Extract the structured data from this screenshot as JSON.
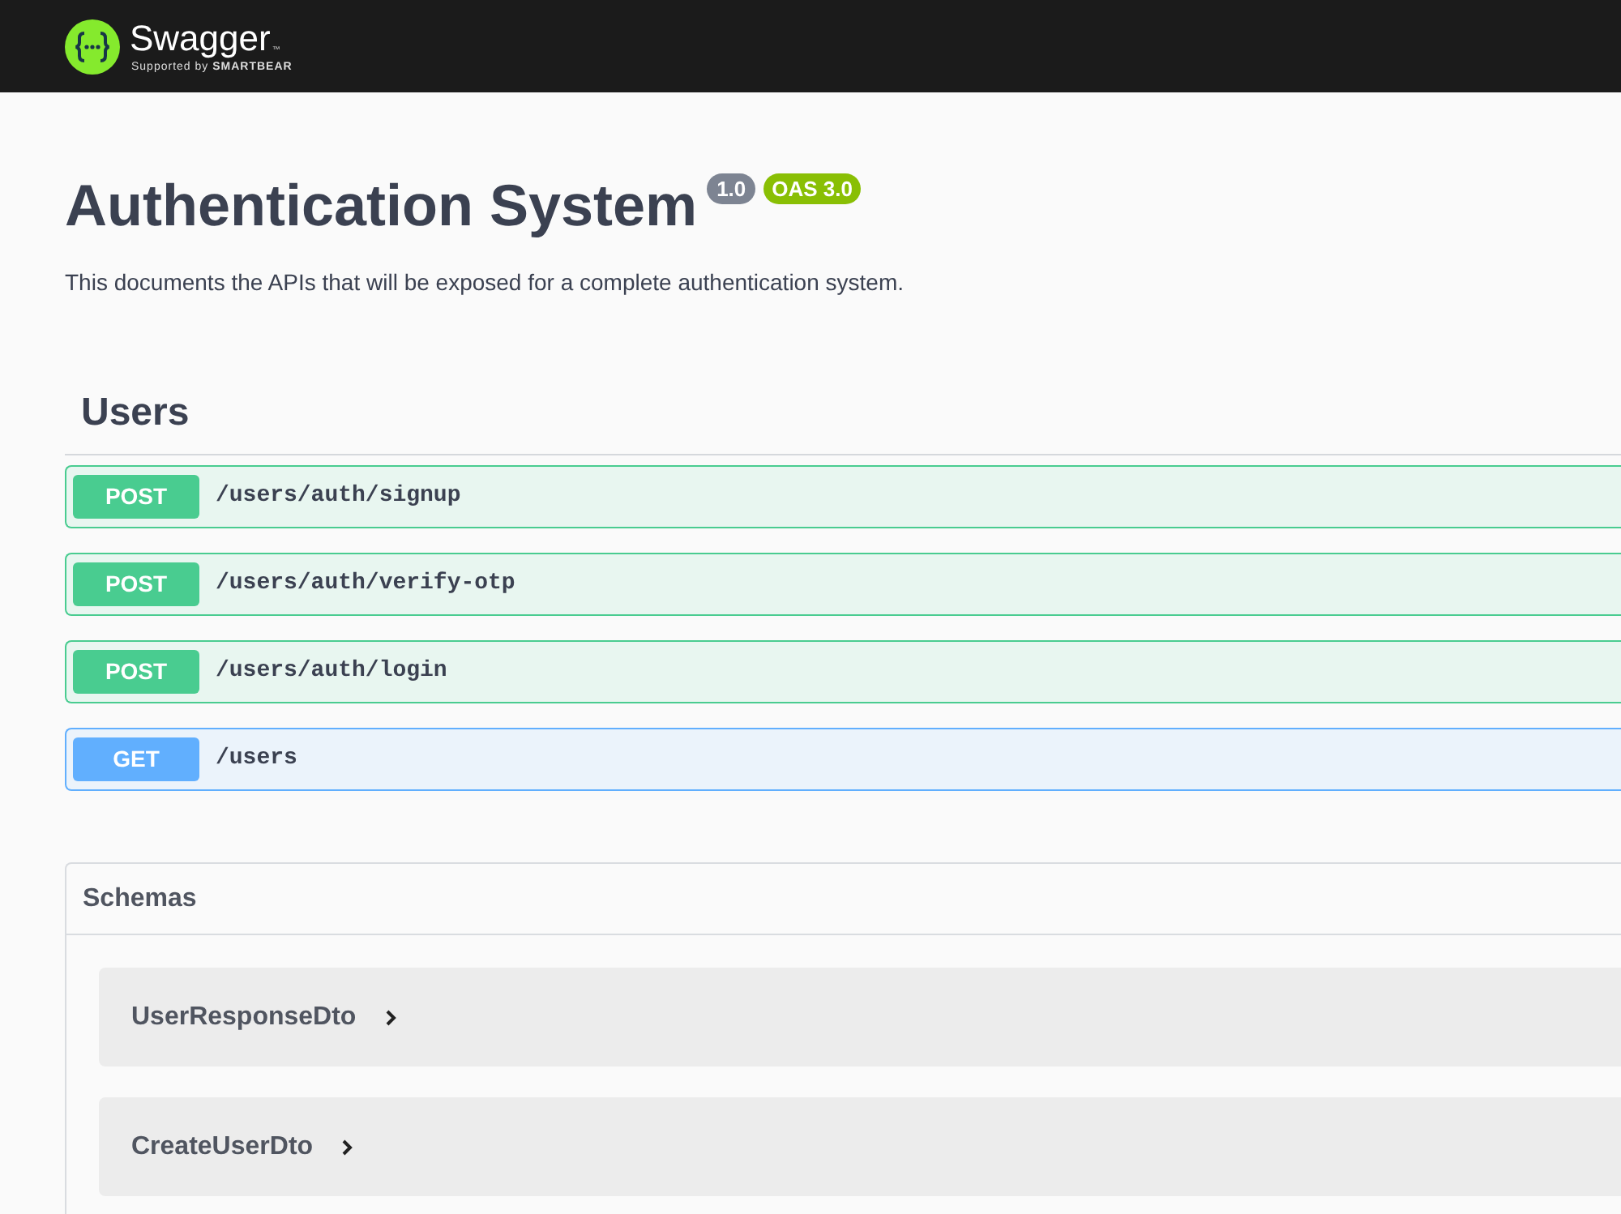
{
  "header": {
    "logo_text": "Swagger",
    "trademark": "™",
    "tagline": "Supported by **SMARTBEAR**"
  },
  "info": {
    "title": "Authentication System",
    "version": "1.0",
    "spec": "OAS 3.0",
    "description": "This documents the APIs that will be exposed for a complete authentication system."
  },
  "tags": [
    {
      "name": "Users",
      "operations": [
        {
          "method": "POST",
          "kind": "post",
          "path": "/users/auth/signup"
        },
        {
          "method": "POST",
          "kind": "post",
          "path": "/users/auth/verify-otp"
        },
        {
          "method": "POST",
          "kind": "post",
          "path": "/users/auth/login"
        },
        {
          "method": "GET",
          "kind": "get",
          "path": "/users"
        }
      ]
    }
  ],
  "schemas": {
    "title": "Schemas",
    "models": [
      {
        "name": "UserResponseDto",
        "expanded": false
      },
      {
        "name": "CreateUserDto",
        "expanded": false
      }
    ]
  }
}
